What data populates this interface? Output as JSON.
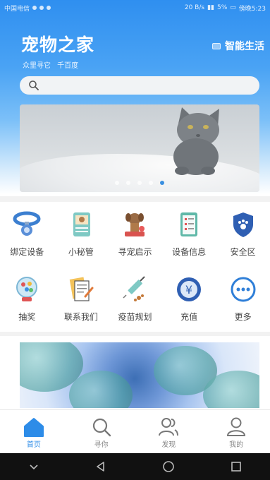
{
  "status_bar": {
    "carrier": "中国电信",
    "speed": "20 B/s",
    "battery": "5%",
    "time": "傍晚5:23"
  },
  "app": {
    "title": "宠物之家",
    "subtitle": "众里寻它 千百度",
    "smart_life": "智能生活"
  },
  "search": {
    "placeholder": ""
  },
  "carousel": {
    "slide_count": 5,
    "active_index": 4
  },
  "features_row1": [
    {
      "label": "绑定设备",
      "icon": "pet-collar-icon"
    },
    {
      "label": "小秘管",
      "icon": "pet-notebook-icon"
    },
    {
      "label": "寻宠启示",
      "icon": "lost-pet-icon"
    },
    {
      "label": "设备信息",
      "icon": "device-info-icon"
    },
    {
      "label": "安全区",
      "icon": "safe-zone-shield-icon"
    }
  ],
  "features_row2": [
    {
      "label": "抽奖",
      "icon": "lottery-icon"
    },
    {
      "label": "联系我们",
      "icon": "contact-us-icon"
    },
    {
      "label": "疫苗规划",
      "icon": "vaccine-icon"
    },
    {
      "label": "充值",
      "icon": "recharge-yen-icon"
    },
    {
      "label": "更多",
      "icon": "more-icon"
    }
  ],
  "tabs": [
    {
      "label": "首页",
      "icon": "home-icon",
      "active": true
    },
    {
      "label": "寻你",
      "icon": "search-icon",
      "active": false
    },
    {
      "label": "发现",
      "icon": "discover-people-icon",
      "active": false
    },
    {
      "label": "我的",
      "icon": "profile-icon",
      "active": false
    }
  ],
  "colors": {
    "header_blue": "#2f8ff0",
    "active_tab": "#2d8ce8",
    "nav_bar": "#111111"
  }
}
